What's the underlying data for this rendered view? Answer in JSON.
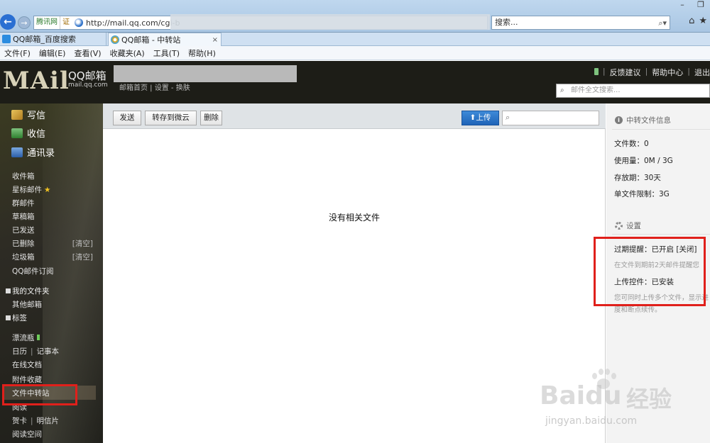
{
  "browser": {
    "address_site": "腾讯网",
    "address_cert": "证",
    "url": "http://mail.qq.com/cgi-b",
    "search_placeholder": "搜索...",
    "tabs": [
      {
        "label": "QQ邮箱_百度搜索"
      },
      {
        "label": "QQ邮箱 - 中转站"
      }
    ],
    "menu": [
      "文件(F)",
      "编辑(E)",
      "查看(V)",
      "收藏夹(A)",
      "工具(T)",
      "帮助(H)"
    ]
  },
  "header": {
    "logo": "MAil",
    "brand_name": "QQ邮箱",
    "brand_domain": "mail.qq.com",
    "nav": "邮箱首页 | 设置 - 换肤",
    "links": [
      "反馈建议",
      "帮助中心",
      "退出"
    ],
    "search_placeholder": "邮件全文搜索..."
  },
  "sidebar": {
    "compose": "写信",
    "receive": "收信",
    "contacts": "通讯录",
    "folders": [
      "收件箱",
      "星标邮件",
      "群邮件",
      "草稿箱",
      "已发送",
      "已删除",
      "垃圾箱",
      "QQ邮件订阅"
    ],
    "clear_label": "[清空]",
    "my_folders": "我的文件夹",
    "other_mailbox": "其他邮箱",
    "tags": "标签",
    "apps": {
      "drift_bottle": "漂流瓶",
      "calendar": "日历",
      "notebook": "记事本",
      "online_docs": "在线文档",
      "attachments": "附件收藏",
      "file_transfer": "文件中转站",
      "reading": "阅读",
      "greeting_card": "贺卡",
      "postcard": "明信片",
      "reading_space": "阅读空间"
    }
  },
  "toolbar": {
    "send": "发送",
    "save_to_cloud": "转存到微云",
    "delete": "删除",
    "upload": "上传"
  },
  "main": {
    "empty_text": "没有相关文件"
  },
  "panel": {
    "info_title": "中转文件信息",
    "file_count": "文件数：0",
    "usage": "使用量：0M / 3G",
    "storage_period": "存放期：30天",
    "single_file_limit": "单文件限制：3G",
    "settings_title": "设置",
    "expiry_reminder": "过期提醒：已开启 [关闭]",
    "expiry_note": "在文件到期前2天邮件提醒您",
    "upload_control": "上传控件：已安装",
    "upload_note_1": "您可同时上传多个文件，显示进",
    "upload_note_2": "度和断点续传。"
  },
  "watermark": {
    "brand": "Bai",
    "brand_2": "du",
    "cn": "经验",
    "url": "jingyan.baidu.com"
  },
  "colors": {
    "highlight_box": "#e0201b",
    "upload_button": "#1f64b8",
    "sidebar_bg": "#2d2b24"
  }
}
